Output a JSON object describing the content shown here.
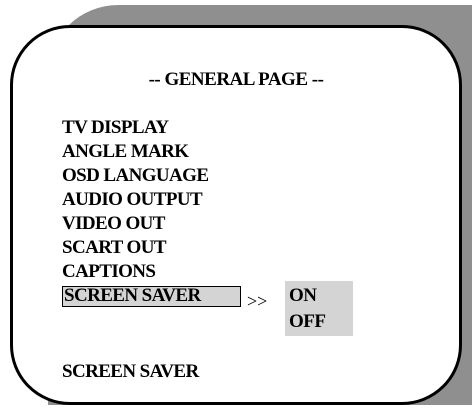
{
  "title": "-- GENERAL PAGE --",
  "menu": {
    "items": [
      {
        "label": "TV DISPLAY"
      },
      {
        "label": "ANGLE MARK"
      },
      {
        "label": "OSD LANGUAGE"
      },
      {
        "label": "AUDIO OUTPUT"
      },
      {
        "label": "VIDEO OUT"
      },
      {
        "label": "SCART OUT"
      },
      {
        "label": "CAPTIONS"
      },
      {
        "label": "SCREEN SAVER"
      }
    ],
    "selected_item": "SCREEN SAVER",
    "arrow": ">>"
  },
  "options": [
    {
      "label": "ON"
    },
    {
      "label": "OFF"
    }
  ],
  "footer": {
    "label": "SCREEN SAVER"
  },
  "colors": {
    "shadow": "#8f8f8f",
    "highlight": "#d4d4d4",
    "text": "#000000",
    "background": "#ffffff"
  }
}
